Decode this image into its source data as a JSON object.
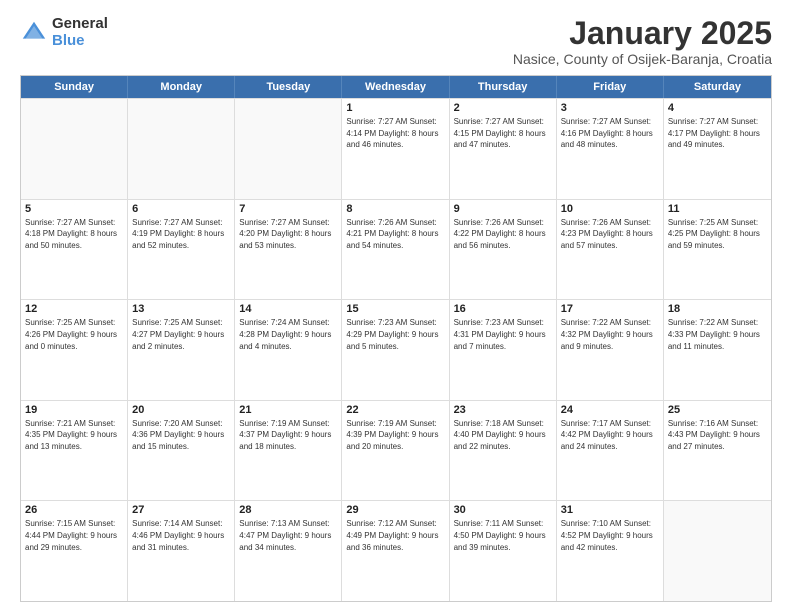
{
  "logo": {
    "general": "General",
    "blue": "Blue"
  },
  "title": "January 2025",
  "subtitle": "Nasice, County of Osijek-Baranja, Croatia",
  "header_days": [
    "Sunday",
    "Monday",
    "Tuesday",
    "Wednesday",
    "Thursday",
    "Friday",
    "Saturday"
  ],
  "weeks": [
    [
      {
        "day": "",
        "info": ""
      },
      {
        "day": "",
        "info": ""
      },
      {
        "day": "",
        "info": ""
      },
      {
        "day": "1",
        "info": "Sunrise: 7:27 AM\nSunset: 4:14 PM\nDaylight: 8 hours and 46 minutes."
      },
      {
        "day": "2",
        "info": "Sunrise: 7:27 AM\nSunset: 4:15 PM\nDaylight: 8 hours and 47 minutes."
      },
      {
        "day": "3",
        "info": "Sunrise: 7:27 AM\nSunset: 4:16 PM\nDaylight: 8 hours and 48 minutes."
      },
      {
        "day": "4",
        "info": "Sunrise: 7:27 AM\nSunset: 4:17 PM\nDaylight: 8 hours and 49 minutes."
      }
    ],
    [
      {
        "day": "5",
        "info": "Sunrise: 7:27 AM\nSunset: 4:18 PM\nDaylight: 8 hours and 50 minutes."
      },
      {
        "day": "6",
        "info": "Sunrise: 7:27 AM\nSunset: 4:19 PM\nDaylight: 8 hours and 52 minutes."
      },
      {
        "day": "7",
        "info": "Sunrise: 7:27 AM\nSunset: 4:20 PM\nDaylight: 8 hours and 53 minutes."
      },
      {
        "day": "8",
        "info": "Sunrise: 7:26 AM\nSunset: 4:21 PM\nDaylight: 8 hours and 54 minutes."
      },
      {
        "day": "9",
        "info": "Sunrise: 7:26 AM\nSunset: 4:22 PM\nDaylight: 8 hours and 56 minutes."
      },
      {
        "day": "10",
        "info": "Sunrise: 7:26 AM\nSunset: 4:23 PM\nDaylight: 8 hours and 57 minutes."
      },
      {
        "day": "11",
        "info": "Sunrise: 7:25 AM\nSunset: 4:25 PM\nDaylight: 8 hours and 59 minutes."
      }
    ],
    [
      {
        "day": "12",
        "info": "Sunrise: 7:25 AM\nSunset: 4:26 PM\nDaylight: 9 hours and 0 minutes."
      },
      {
        "day": "13",
        "info": "Sunrise: 7:25 AM\nSunset: 4:27 PM\nDaylight: 9 hours and 2 minutes."
      },
      {
        "day": "14",
        "info": "Sunrise: 7:24 AM\nSunset: 4:28 PM\nDaylight: 9 hours and 4 minutes."
      },
      {
        "day": "15",
        "info": "Sunrise: 7:23 AM\nSunset: 4:29 PM\nDaylight: 9 hours and 5 minutes."
      },
      {
        "day": "16",
        "info": "Sunrise: 7:23 AM\nSunset: 4:31 PM\nDaylight: 9 hours and 7 minutes."
      },
      {
        "day": "17",
        "info": "Sunrise: 7:22 AM\nSunset: 4:32 PM\nDaylight: 9 hours and 9 minutes."
      },
      {
        "day": "18",
        "info": "Sunrise: 7:22 AM\nSunset: 4:33 PM\nDaylight: 9 hours and 11 minutes."
      }
    ],
    [
      {
        "day": "19",
        "info": "Sunrise: 7:21 AM\nSunset: 4:35 PM\nDaylight: 9 hours and 13 minutes."
      },
      {
        "day": "20",
        "info": "Sunrise: 7:20 AM\nSunset: 4:36 PM\nDaylight: 9 hours and 15 minutes."
      },
      {
        "day": "21",
        "info": "Sunrise: 7:19 AM\nSunset: 4:37 PM\nDaylight: 9 hours and 18 minutes."
      },
      {
        "day": "22",
        "info": "Sunrise: 7:19 AM\nSunset: 4:39 PM\nDaylight: 9 hours and 20 minutes."
      },
      {
        "day": "23",
        "info": "Sunrise: 7:18 AM\nSunset: 4:40 PM\nDaylight: 9 hours and 22 minutes."
      },
      {
        "day": "24",
        "info": "Sunrise: 7:17 AM\nSunset: 4:42 PM\nDaylight: 9 hours and 24 minutes."
      },
      {
        "day": "25",
        "info": "Sunrise: 7:16 AM\nSunset: 4:43 PM\nDaylight: 9 hours and 27 minutes."
      }
    ],
    [
      {
        "day": "26",
        "info": "Sunrise: 7:15 AM\nSunset: 4:44 PM\nDaylight: 9 hours and 29 minutes."
      },
      {
        "day": "27",
        "info": "Sunrise: 7:14 AM\nSunset: 4:46 PM\nDaylight: 9 hours and 31 minutes."
      },
      {
        "day": "28",
        "info": "Sunrise: 7:13 AM\nSunset: 4:47 PM\nDaylight: 9 hours and 34 minutes."
      },
      {
        "day": "29",
        "info": "Sunrise: 7:12 AM\nSunset: 4:49 PM\nDaylight: 9 hours and 36 minutes."
      },
      {
        "day": "30",
        "info": "Sunrise: 7:11 AM\nSunset: 4:50 PM\nDaylight: 9 hours and 39 minutes."
      },
      {
        "day": "31",
        "info": "Sunrise: 7:10 AM\nSunset: 4:52 PM\nDaylight: 9 hours and 42 minutes."
      },
      {
        "day": "",
        "info": ""
      }
    ]
  ]
}
